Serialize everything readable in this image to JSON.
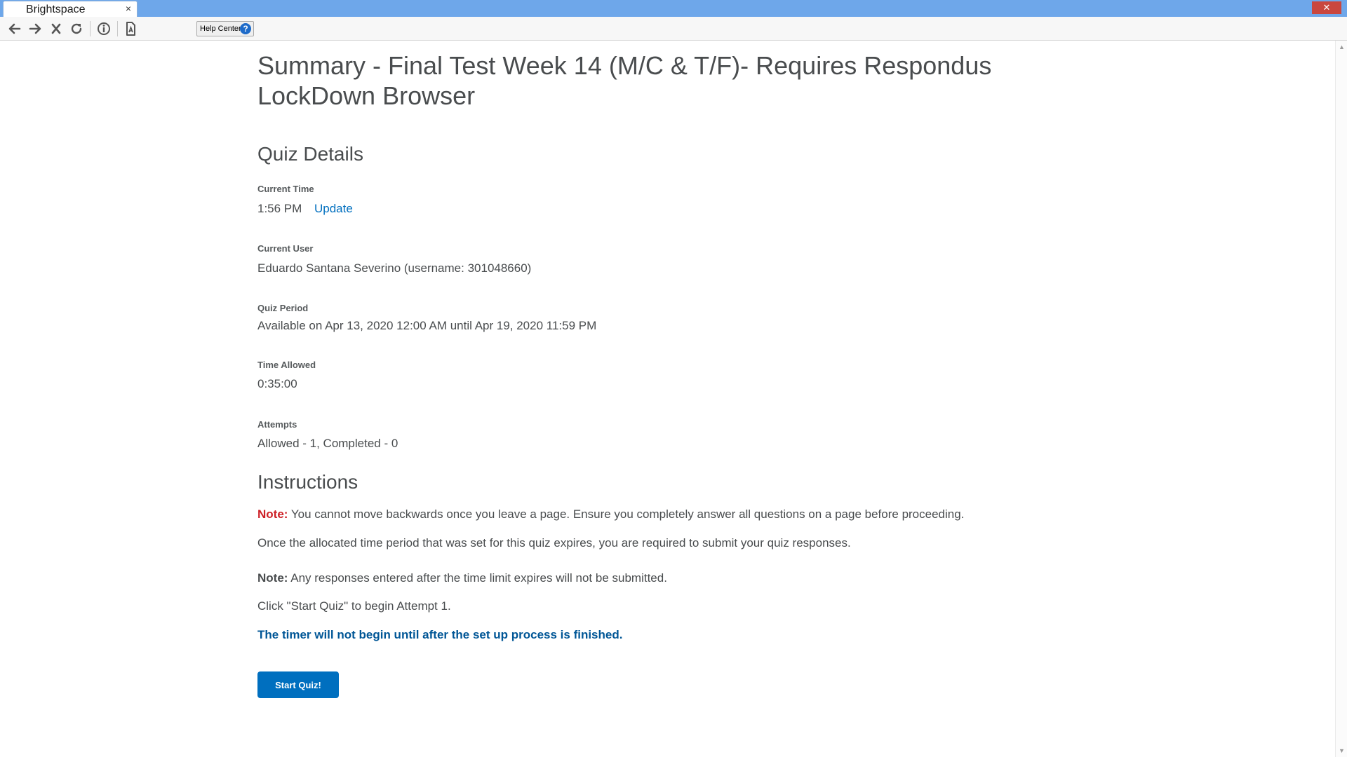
{
  "browser": {
    "tab_title": "Brightspace",
    "tab_close": "×",
    "window_close": "✕",
    "help_button_label": "Help Center",
    "help_icon_glyph": "?",
    "icons": [
      "back-arrow-icon",
      "forward-arrow-icon",
      "stop-icon",
      "reload-icon",
      "info-icon",
      "document-icon"
    ],
    "accent_color": "#6ea7ea"
  },
  "page": {
    "title": "Summary - Final Test Week 14 (M/C & T/F)- Requires Respondus LockDown Browser",
    "quiz_details": {
      "heading": "Quiz Details",
      "current_time_label": "Current Time",
      "current_time_value": "1:56 PM",
      "update_link": "Update",
      "current_user_label": "Current User",
      "current_user_value": "Eduardo Santana Severino (username: 301048660)",
      "quiz_period_label": "Quiz Period",
      "quiz_period_value": "Available on Apr 13, 2020 12:00 AM until Apr 19, 2020 11:59 PM",
      "time_allowed_label": "Time Allowed",
      "time_allowed_value": "0:35:00",
      "attempts_label": "Attempts",
      "attempts_value": "Allowed - 1, Completed - 0"
    },
    "instructions": {
      "heading": "Instructions",
      "note1_prefix": "Note:",
      "note1_text": " You cannot move backwards once you leave a page. Ensure you completely answer all questions on a page before proceeding.",
      "para2": "Once the allocated time period that was set for this quiz expires, you are required to submit your quiz responses.",
      "note2_prefix": "Note:",
      "note2_text": " Any responses entered after the time limit expires will not be submitted.",
      "para4": "Click \"Start Quiz\" to begin Attempt 1.",
      "timer_note": "The timer will not begin until after the set up process is finished."
    },
    "start_button": "Start Quiz!",
    "colors": {
      "note_red": "#cd2026",
      "link_blue": "#006fbf",
      "button_blue": "#006fbf",
      "timer_blue": "#005696"
    }
  }
}
